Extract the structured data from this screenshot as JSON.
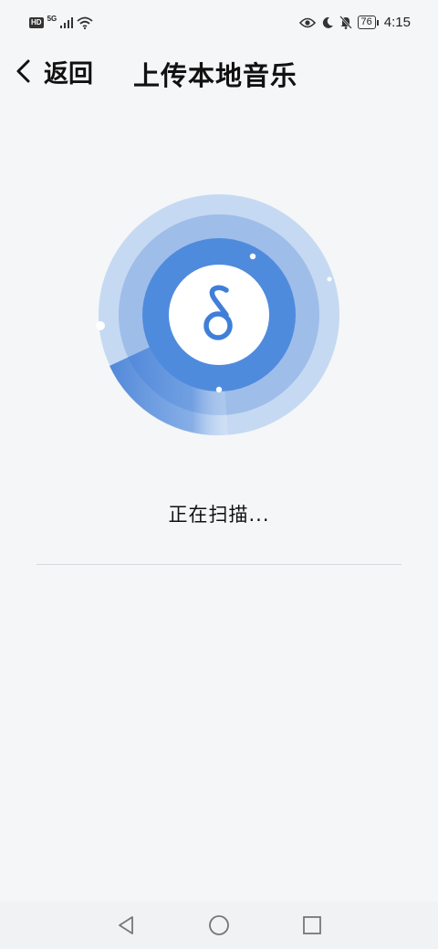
{
  "status_bar": {
    "hd_label": "HD",
    "network_label": "5G",
    "battery_level": "76",
    "time": "4:15",
    "icons": [
      "hd-icon",
      "signal-icon",
      "wifi-icon",
      "eye-icon",
      "moon-icon",
      "bell-off-icon",
      "battery-icon"
    ]
  },
  "header": {
    "back_label": "返回",
    "title": "上传本地音乐"
  },
  "scan": {
    "status_text": "正在扫描...",
    "icon": "music-note-icon",
    "colors": {
      "outer_ring": "#c6d9f2",
      "middle_ring": "#9ebde9",
      "inner_ring": "#4f8bdd",
      "note": "#3f7fd9",
      "center": "#ffffff"
    }
  },
  "nav_bar": {
    "icons": [
      "back-triangle-icon",
      "home-circle-icon",
      "recents-square-icon"
    ]
  }
}
